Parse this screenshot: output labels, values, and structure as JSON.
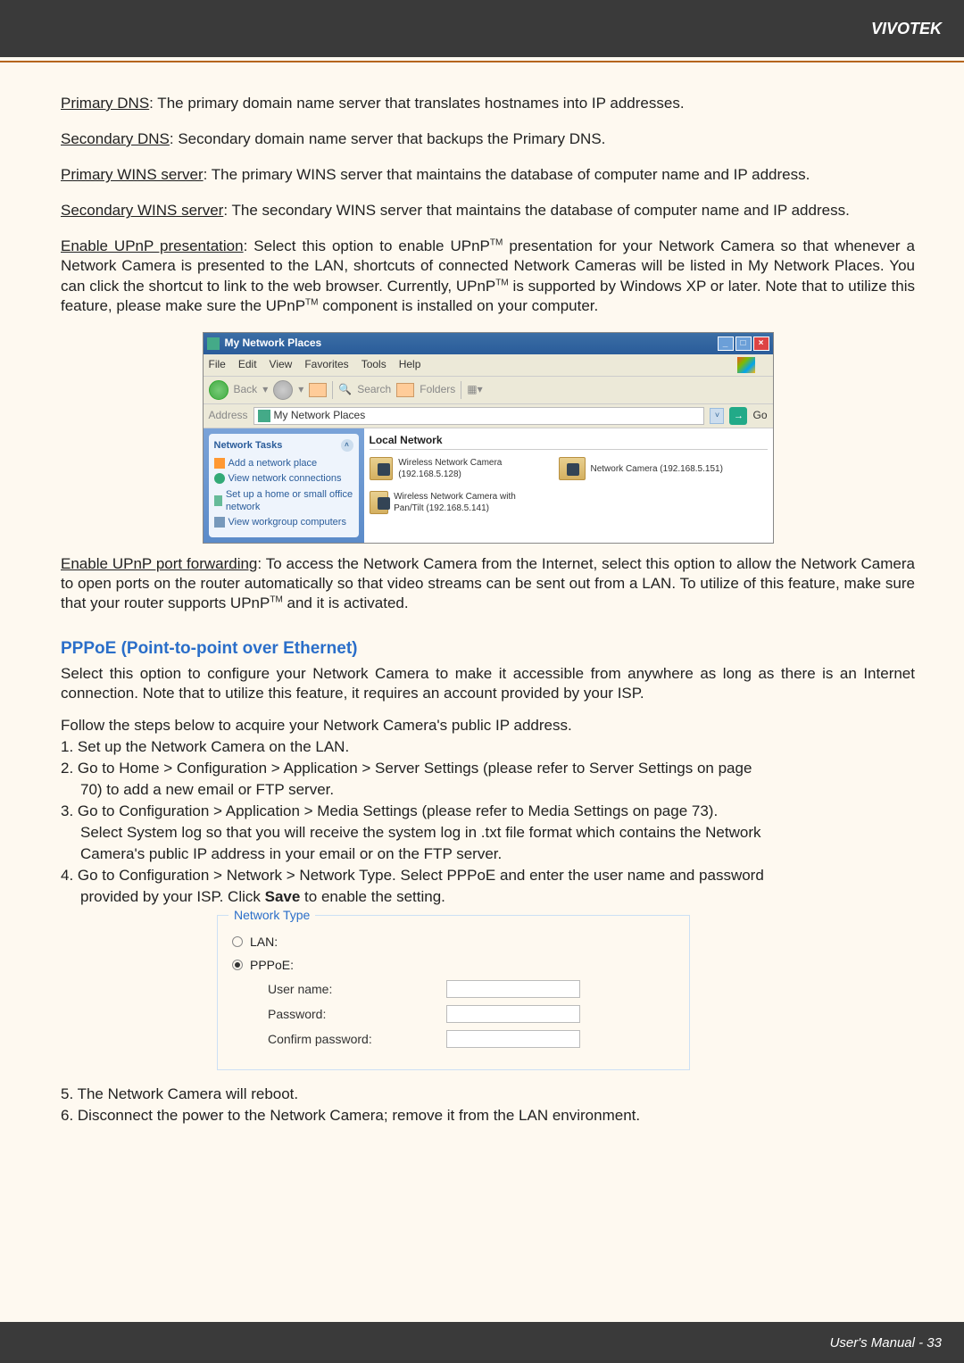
{
  "brand": "VIVOTEK",
  "footer_text": "User's Manual - 33",
  "defs": {
    "primary_dns_label": "Primary DNS",
    "primary_dns_text": ": The primary domain name server that translates hostnames into IP addresses.",
    "secondary_dns_label": "Secondary DNS",
    "secondary_dns_text": ": Secondary domain name server that backups the Primary DNS.",
    "primary_wins_label": "Primary WINS server",
    "primary_wins_text": ": The primary WINS server that maintains the database of computer name and IP address.",
    "secondary_wins_label": "Secondary WINS server",
    "secondary_wins_text": ": The secondary WINS server that maintains the database of computer name and IP address.",
    "upnp_pres_label": "Enable UPnP presentation",
    "upnp_pres_text_a": ": Select this option to enable UPnP",
    "upnp_pres_text_b": " presentation for your Network Camera so that whenever a Network Camera is presented to the LAN, shortcuts of connected Network Cameras will be listed in My Network Places. You can click the shortcut to link to the web browser. Currently, UPnP",
    "upnp_pres_text_c": " is supported by Windows XP or later. Note that to utilize this feature, please make sure the UPnP",
    "upnp_pres_text_d": " component is installed on your computer.",
    "upnp_fwd_label": "Enable UPnP port forwarding",
    "upnp_fwd_text_a": ": To access the Network Camera from the Internet, select this option to allow the Network Camera to open ports on the router automatically so that video streams can be sent out from a LAN. To utilize of this feature, make sure that your router supports UPnP",
    "upnp_fwd_text_b": " and it is activated."
  },
  "pppoe": {
    "title": "PPPoE (Point-to-point over Ethernet)",
    "intro": "Select this option to configure your Network Camera to make it accessible from anywhere as long as there is an Internet connection. Note that to utilize this feature, it requires an account provided by your ISP.",
    "follow": "Follow the steps below to acquire your Network Camera's public IP address.",
    "s1": "1. Set up the Network Camera on the LAN.",
    "s2a": "2. Go to Home > Configuration > Application > Server Settings (please refer to Server Settings on page",
    "s2b": "70) to add a new email or FTP server.",
    "s3a": "3. Go to Configuration > Application > Media Settings (please refer to Media Settings on page 73).",
    "s3b": "Select System log so that you will receive the system log in .txt file format which contains the Network",
    "s3c": "Camera's public IP address in your email or on the FTP server.",
    "s4a": "4. Go to Configuration > Network > Network Type. Select PPPoE and enter the user name and password",
    "s4b_pre": "provided by your ISP. Click ",
    "s4b_bold": "Save",
    "s4b_post": " to enable the setting.",
    "s5": "5. The Network Camera will reboot.",
    "s6": "6. Disconnect the power to the Network Camera; remove it from the LAN environment."
  },
  "win": {
    "title": "My Network Places",
    "menu": [
      "File",
      "Edit",
      "View",
      "Favorites",
      "Tools",
      "Help"
    ],
    "back": "Back",
    "search": "Search",
    "folders": "Folders",
    "address_label": "Address",
    "address_value": "My Network Places",
    "go": "Go",
    "side_header": "Network Tasks",
    "side_items": [
      "Add a network place",
      "View network connections",
      "Set up a home or small office network",
      "View workgroup computers"
    ],
    "main_header": "Local Network",
    "items": [
      {
        "name": "Wireless Network Camera (192.168.5.128)"
      },
      {
        "name": "Network Camera (192.168.5.151)"
      },
      {
        "name": "Wireless Network Camera with Pan/Tilt (192.168.5.141)"
      }
    ]
  },
  "nt": {
    "legend": "Network Type",
    "lan": "LAN:",
    "pppoe": "PPPoE:",
    "user": "User name:",
    "pass": "Password:",
    "confirm": "Confirm password:"
  },
  "tm": "TM"
}
